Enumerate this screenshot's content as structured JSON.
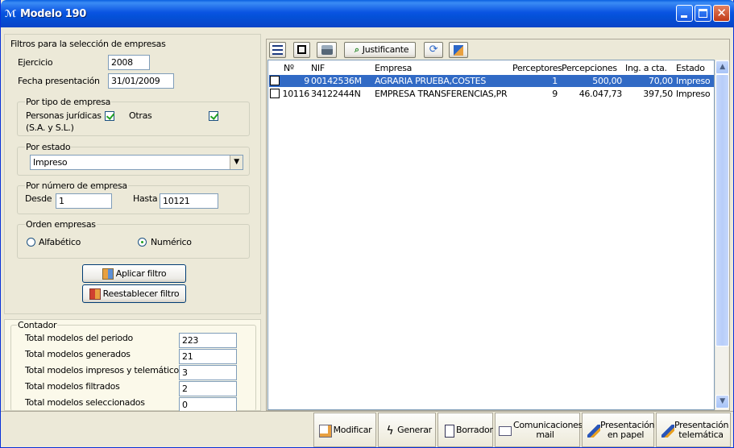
{
  "window": {
    "title": "Modelo 190"
  },
  "filters": {
    "group_title": "Filtros para la selección de empresas",
    "ejercicio_label": "Ejercicio",
    "ejercicio_value": "2008",
    "fecha_label": "Fecha presentación",
    "fecha_value": "31/01/2009",
    "tipo": {
      "title": "Por tipo de empresa",
      "juridicas_label_1": "Personas jurídicas",
      "juridicas_label_2": "(S.A. y S.L.)",
      "juridicas_checked": true,
      "otras_label": "Otras",
      "otras_checked": true
    },
    "estado": {
      "title": "Por estado",
      "selected": "Impreso"
    },
    "numero": {
      "title": "Por número de empresa",
      "desde_label": "Desde",
      "desde_value": "1",
      "hasta_label": "Hasta",
      "hasta_value": "10121"
    },
    "orden": {
      "title": "Orden empresas",
      "alfabetico_label": "Alfabético",
      "numerico_label": "Numérico",
      "selected": "Numérico"
    },
    "aplicar_label": "Aplicar filtro",
    "reestablecer_label": "Reestablecer filtro"
  },
  "contador": {
    "title": "Contador",
    "items": [
      {
        "label": "Total modelos del periodo",
        "value": "223"
      },
      {
        "label": "Total modelos generados",
        "value": "21"
      },
      {
        "label": "Total modelos impresos y telemáticos",
        "value": "3"
      },
      {
        "label": "Total modelos filtrados",
        "value": "2"
      },
      {
        "label": "Total modelos seleccionados",
        "value": "0"
      }
    ]
  },
  "toolbar": {
    "justificante_label": "Justificante"
  },
  "grid": {
    "columns": {
      "num": "Nº",
      "nif": "NIF",
      "empresa": "Empresa",
      "perceptores": "Perceptores",
      "percepciones": "Percepciones",
      "ing": "Ing. a cta.",
      "estado": "Estado"
    },
    "rows": [
      {
        "num": "9",
        "nif": "00142536M",
        "empresa": "AGRARIA PRUEBA,COSTES",
        "perceptores": "1",
        "percepciones": "500,00",
        "ing": "70,00",
        "estado": "Impreso",
        "selected": true
      },
      {
        "num": "10116",
        "nif": "34122444N",
        "empresa": "EMPRESA TRANSFERENCIAS,PR",
        "perceptores": "9",
        "percepciones": "46.047,73",
        "ing": "397,50",
        "estado": "Impreso",
        "selected": false
      }
    ]
  },
  "actions": {
    "modificar": "Modificar",
    "generar": "Generar",
    "borrador": "Borrador",
    "comunicaciones_1": "Comunicaciones",
    "comunicaciones_2": "mail",
    "papel_1": "Presentación",
    "papel_2": "en papel",
    "telematica_1": "Presentación",
    "telematica_2": "telemática"
  },
  "colors": {
    "titlebar": "#0a54e2",
    "selection": "#316ac5",
    "window_bg": "#ece9d8"
  }
}
